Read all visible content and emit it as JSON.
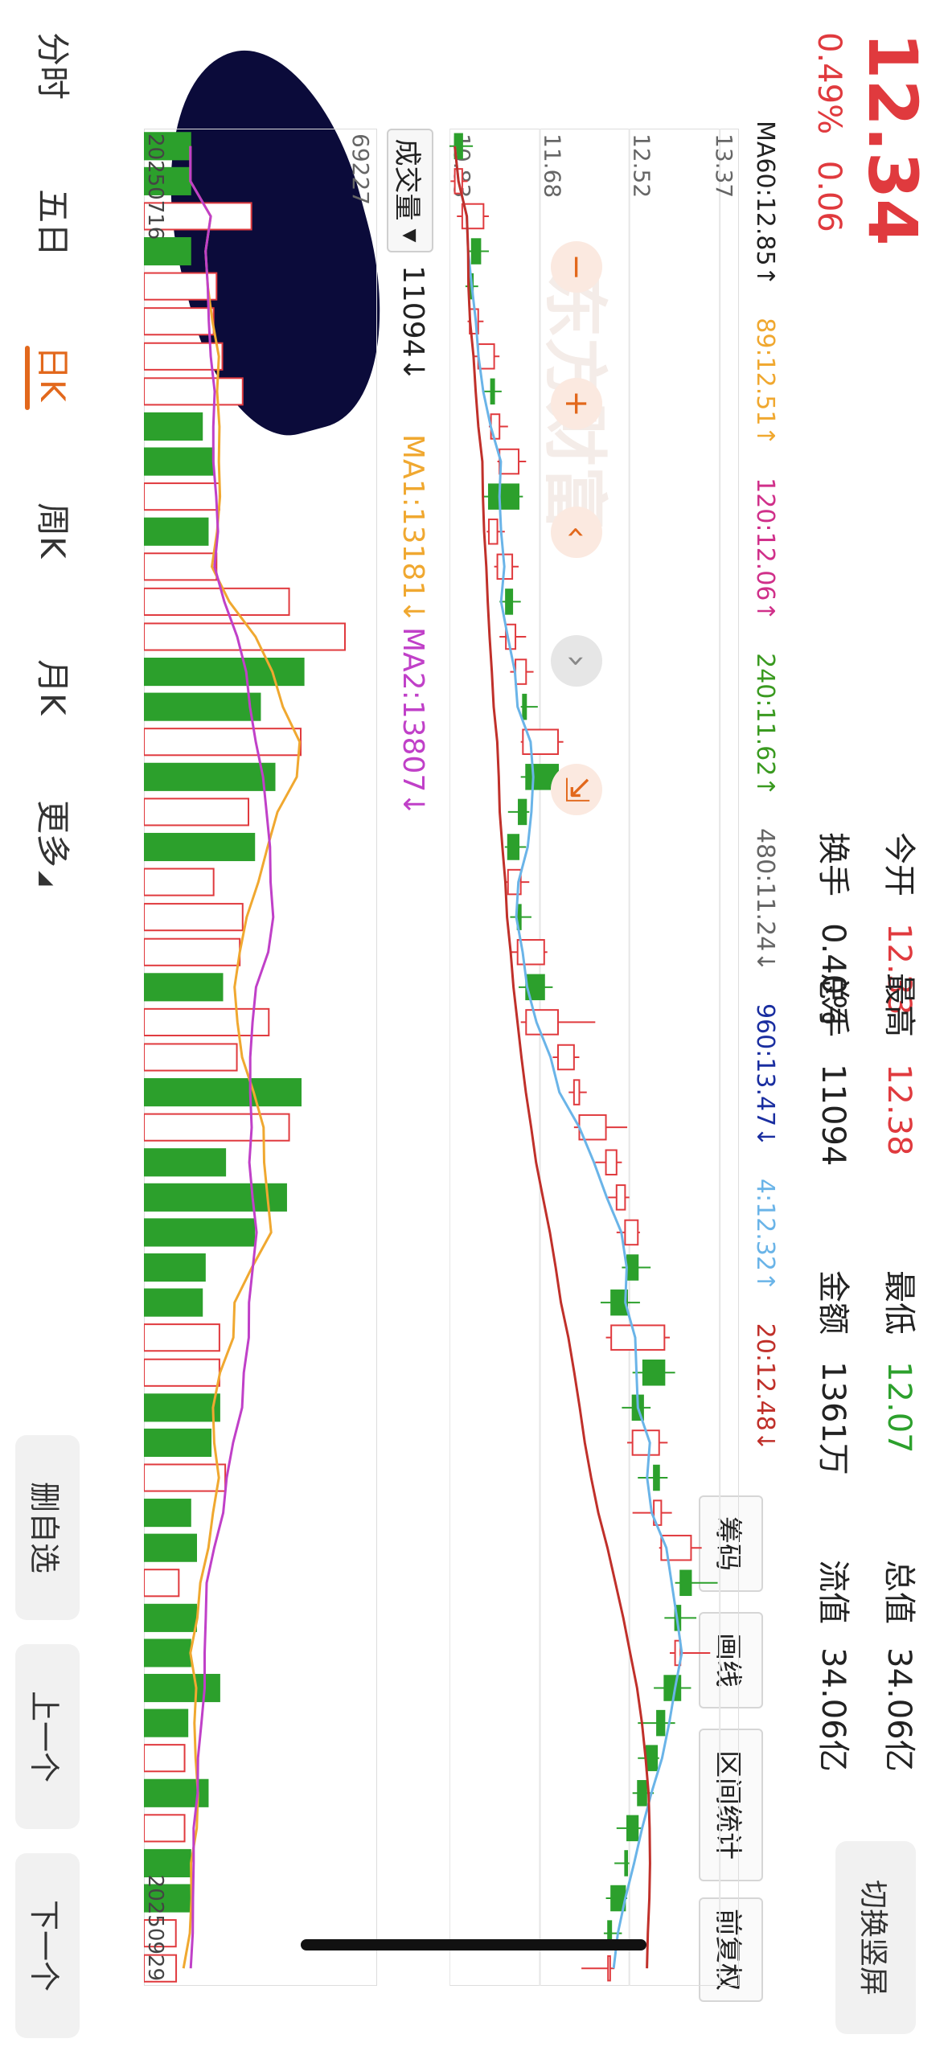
{
  "quote": {
    "price": "12.34",
    "change_pct": "0.49%",
    "change_abs": "0.06",
    "stats": [
      {
        "label": "今开",
        "value": "12.33",
        "color": "red"
      },
      {
        "label": "最高",
        "value": "12.38",
        "color": "red"
      },
      {
        "label": "最低",
        "value": "12.07",
        "color": "green"
      },
      {
        "label": "总值",
        "value": "34.06亿",
        "color": "black"
      },
      {
        "label": "换手",
        "value": "0.40%",
        "color": "black"
      },
      {
        "label": "总手",
        "value": "11094",
        "color": "black"
      },
      {
        "label": "金额",
        "value": "1361万",
        "color": "black"
      },
      {
        "label": "流值",
        "value": "34.06亿",
        "color": "black"
      }
    ]
  },
  "toolbar": {
    "chips": "筹码",
    "draw": "画线",
    "interval": "区间统计",
    "adjust": "前复权",
    "switch_portrait": "切换竖屏"
  },
  "ma_legend": [
    {
      "text": "MA60:12.85↑",
      "color": "#222222"
    },
    {
      "text": "89:12.51↑",
      "color": "#f0a830"
    },
    {
      "text": "120:12.06↑",
      "color": "#d0308a"
    },
    {
      "text": "240:11.62↑",
      "color": "#3a9a20"
    },
    {
      "text": "480:11.24↓",
      "color": "#666666"
    },
    {
      "text": "960:13.47↓",
      "color": "#1a2ea0"
    },
    {
      "text": "4:12.32↑",
      "color": "#6ab4e8"
    },
    {
      "text": "20:12.48↓",
      "color": "#c0302a"
    }
  ],
  "volume": {
    "select_label": "成交量",
    "max_label": "69227",
    "current": "11094↓",
    "ma1": "MA1:13181↓",
    "ma2": "MA2:13807↓",
    "ma1_color": "#f0a830",
    "ma2_color": "#c040c8"
  },
  "tabs": [
    "分时",
    "五日",
    "日K",
    "周K",
    "月K",
    "更多"
  ],
  "active_tab": 2,
  "actions": {
    "remove_watch": "删自选",
    "prev": "上一个",
    "next": "下一个"
  },
  "colors": {
    "up": "#e03a3e",
    "down": "#2ca02c",
    "accent": "#e2681c"
  },
  "chart_data": {
    "type": "candlestick",
    "y_ticks": [
      "13.37",
      "12.52",
      "11.68",
      "10.83"
    ],
    "ylim": [
      10.83,
      13.55
    ],
    "x_start": "20250716",
    "x_end": "20250929",
    "candles": [
      {
        "o": 10.95,
        "c": 10.88,
        "h": 11.05,
        "l": 10.83
      },
      {
        "o": 10.88,
        "c": 10.95,
        "h": 11.0,
        "l": 10.84
      },
      {
        "o": 10.95,
        "c": 11.15,
        "h": 11.2,
        "l": 10.9
      },
      {
        "o": 11.12,
        "c": 11.04,
        "h": 11.2,
        "l": 11.0
      },
      {
        "o": 11.05,
        "c": 11.02,
        "h": 11.1,
        "l": 10.98
      },
      {
        "o": 11.02,
        "c": 11.1,
        "h": 11.15,
        "l": 11.0
      },
      {
        "o": 11.1,
        "c": 11.25,
        "h": 11.3,
        "l": 11.05
      },
      {
        "o": 11.25,
        "c": 11.22,
        "h": 11.32,
        "l": 11.15
      },
      {
        "o": 11.22,
        "c": 11.3,
        "h": 11.38,
        "l": 11.2
      },
      {
        "o": 11.3,
        "c": 11.48,
        "h": 11.55,
        "l": 11.28
      },
      {
        "o": 11.48,
        "c": 11.2,
        "h": 11.52,
        "l": 11.15
      },
      {
        "o": 11.2,
        "c": 11.28,
        "h": 11.35,
        "l": 11.18
      },
      {
        "o": 11.28,
        "c": 11.42,
        "h": 11.48,
        "l": 11.25
      },
      {
        "o": 11.42,
        "c": 11.36,
        "h": 11.5,
        "l": 11.3
      },
      {
        "o": 11.36,
        "c": 11.45,
        "h": 11.55,
        "l": 11.3
      },
      {
        "o": 11.45,
        "c": 11.55,
        "h": 11.62,
        "l": 11.4
      },
      {
        "o": 11.55,
        "c": 11.52,
        "h": 11.66,
        "l": 11.5
      },
      {
        "o": 11.52,
        "c": 11.85,
        "h": 11.9,
        "l": 11.5
      },
      {
        "o": 11.85,
        "c": 11.55,
        "h": 11.92,
        "l": 11.5
      },
      {
        "o": 11.55,
        "c": 11.48,
        "h": 11.58,
        "l": 11.38
      },
      {
        "o": 11.48,
        "c": 11.38,
        "h": 11.55,
        "l": 11.35
      },
      {
        "o": 11.38,
        "c": 11.5,
        "h": 11.58,
        "l": 11.35
      },
      {
        "o": 11.5,
        "c": 11.47,
        "h": 11.6,
        "l": 11.4
      },
      {
        "o": 11.47,
        "c": 11.72,
        "h": 11.75,
        "l": 11.4
      },
      {
        "o": 11.72,
        "c": 11.55,
        "h": 11.8,
        "l": 11.48
      },
      {
        "o": 11.55,
        "c": 11.85,
        "h": 12.2,
        "l": 11.5
      },
      {
        "o": 11.85,
        "c": 12.0,
        "h": 12.05,
        "l": 11.8
      },
      {
        "o": 12.0,
        "c": 12.05,
        "h": 12.12,
        "l": 11.95
      },
      {
        "o": 12.05,
        "c": 12.3,
        "h": 12.5,
        "l": 12.0
      },
      {
        "o": 12.3,
        "c": 12.4,
        "h": 12.45,
        "l": 12.2
      },
      {
        "o": 12.4,
        "c": 12.48,
        "h": 12.52,
        "l": 12.32
      },
      {
        "o": 12.48,
        "c": 12.6,
        "h": 12.62,
        "l": 12.4
      },
      {
        "o": 12.6,
        "c": 12.5,
        "h": 12.72,
        "l": 12.45
      },
      {
        "o": 12.5,
        "c": 12.35,
        "h": 12.62,
        "l": 12.25
      },
      {
        "o": 12.35,
        "c": 12.85,
        "h": 12.9,
        "l": 12.3
      },
      {
        "o": 12.85,
        "c": 12.65,
        "h": 12.95,
        "l": 12.55
      },
      {
        "o": 12.65,
        "c": 12.55,
        "h": 12.72,
        "l": 12.45
      },
      {
        "o": 12.55,
        "c": 12.8,
        "h": 12.88,
        "l": 12.5
      },
      {
        "o": 12.8,
        "c": 12.75,
        "h": 12.88,
        "l": 12.6
      },
      {
        "o": 12.75,
        "c": 12.82,
        "h": 12.92,
        "l": 12.55
      },
      {
        "o": 12.82,
        "c": 13.1,
        "h": 13.2,
        "l": 12.8
      },
      {
        "o": 13.1,
        "c": 13.0,
        "h": 13.35,
        "l": 12.95
      },
      {
        "o": 13.0,
        "c": 12.95,
        "h": 13.15,
        "l": 12.85
      },
      {
        "o": 12.95,
        "c": 13.0,
        "h": 13.28,
        "l": 12.9
      },
      {
        "o": 13.0,
        "c": 12.85,
        "h": 13.1,
        "l": 12.75
      },
      {
        "o": 12.85,
        "c": 12.78,
        "h": 12.95,
        "l": 12.6
      },
      {
        "o": 12.78,
        "c": 12.68,
        "h": 12.8,
        "l": 12.6
      },
      {
        "o": 12.68,
        "c": 12.6,
        "h": 12.75,
        "l": 12.55
      },
      {
        "o": 12.6,
        "c": 12.5,
        "h": 12.65,
        "l": 12.4
      },
      {
        "o": 12.5,
        "c": 12.48,
        "h": 12.52,
        "l": 12.38
      },
      {
        "o": 12.48,
        "c": 12.35,
        "h": 12.5,
        "l": 12.3
      },
      {
        "o": 12.35,
        "c": 12.32,
        "h": 12.45,
        "l": 12.28
      },
      {
        "o": 12.32,
        "c": 12.34,
        "h": 12.38,
        "l": 12.07
      }
    ],
    "volumes": [
      {
        "v": 16000,
        "up": false
      },
      {
        "v": 16000,
        "up": false
      },
      {
        "v": 37000,
        "up": true
      },
      {
        "v": 16000,
        "up": false
      },
      {
        "v": 25000,
        "up": true
      },
      {
        "v": 24000,
        "up": true
      },
      {
        "v": 27000,
        "up": true
      },
      {
        "v": 34000,
        "up": true
      },
      {
        "v": 20000,
        "up": false
      },
      {
        "v": 24000,
        "up": false
      },
      {
        "v": 26000,
        "up": true
      },
      {
        "v": 22000,
        "up": false
      },
      {
        "v": 25000,
        "up": true
      },
      {
        "v": 50000,
        "up": true
      },
      {
        "v": 69227,
        "up": true
      },
      {
        "v": 55000,
        "up": false
      },
      {
        "v": 40000,
        "up": false
      },
      {
        "v": 54000,
        "up": true
      },
      {
        "v": 45000,
        "up": false
      },
      {
        "v": 36000,
        "up": true
      },
      {
        "v": 38000,
        "up": false
      },
      {
        "v": 24000,
        "up": true
      },
      {
        "v": 34000,
        "up": true
      },
      {
        "v": 33000,
        "up": true
      },
      {
        "v": 27000,
        "up": false
      },
      {
        "v": 43000,
        "up": true
      },
      {
        "v": 32000,
        "up": true
      },
      {
        "v": 54000,
        "up": false
      },
      {
        "v": 50000,
        "up": true
      },
      {
        "v": 28000,
        "up": false
      },
      {
        "v": 49000,
        "up": false
      },
      {
        "v": 38000,
        "up": false
      },
      {
        "v": 21000,
        "up": false
      },
      {
        "v": 20000,
        "up": false
      },
      {
        "v": 26000,
        "up": true
      },
      {
        "v": 26000,
        "up": true
      },
      {
        "v": 26000,
        "up": false
      },
      {
        "v": 23000,
        "up": false
      },
      {
        "v": 28000,
        "up": true
      },
      {
        "v": 16000,
        "up": false
      },
      {
        "v": 18000,
        "up": false
      },
      {
        "v": 12000,
        "up": true
      },
      {
        "v": 18000,
        "up": false
      },
      {
        "v": 16000,
        "up": false
      },
      {
        "v": 26000,
        "up": false
      },
      {
        "v": 15000,
        "up": false
      },
      {
        "v": 14000,
        "up": true
      },
      {
        "v": 22000,
        "up": false
      },
      {
        "v": 14000,
        "up": true
      },
      {
        "v": 16000,
        "up": false
      },
      {
        "v": 16000,
        "up": false
      },
      {
        "v": 11000,
        "up": true
      },
      {
        "v": 11094,
        "up": true
      }
    ]
  }
}
